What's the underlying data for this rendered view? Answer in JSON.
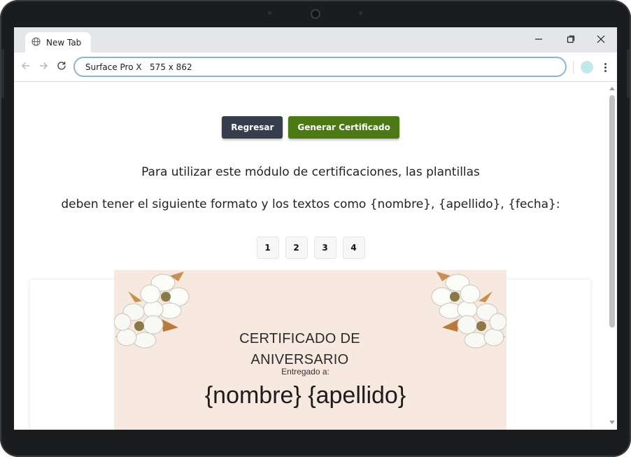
{
  "browser": {
    "tab_title": "New Tab",
    "address": "Surface Pro X   575 x 862"
  },
  "page": {
    "back_button": "Regresar",
    "generate_button": "Generar Certificado",
    "intro_line1": "Para utilizar este módulo de certificaciones, las plantillas",
    "intro_line2": "deben tener el siguiente formato y los textos como {nombre}, {apellido}, {fecha}:",
    "pages": [
      "1",
      "2",
      "3",
      "4"
    ]
  },
  "certificate": {
    "title_line1": "CERTIFICADO DE",
    "title_line2": "ANIVERSARIO",
    "subtitle": "Entregado a:",
    "name_placeholder": "{nombre} {apellido}"
  },
  "colors": {
    "back_button": "#363d4c",
    "generate_button": "#4b7a15",
    "certificate_background": "#f7e9df",
    "omnibox_border": "#8fb2d9"
  }
}
